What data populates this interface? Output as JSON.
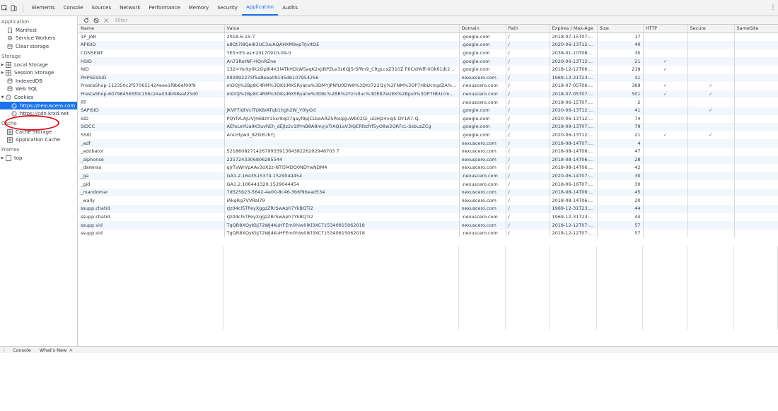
{
  "tabbar": {
    "tabs": [
      "Elements",
      "Console",
      "Sources",
      "Network",
      "Performance",
      "Memory",
      "Security",
      "Application",
      "Audits"
    ],
    "active": "Application"
  },
  "sidebar": {
    "application_heading": "Application",
    "manifest": "Manifest",
    "service_workers": "Service Workers",
    "clear_storage": "Clear storage",
    "storage_heading": "Storage",
    "local_storage": "Local Storage",
    "session_storage": "Session Storage",
    "indexeddb": "IndexedDB",
    "web_sql": "Web SQL",
    "cookies": "Cookies",
    "cookie_origin_1": "https://nexuscero.com",
    "cookie_origin_2": "https://cdn.krxd.net",
    "cache_heading": "Cache",
    "cache_storage": "Cache Storage",
    "application_cache": "Application Cache",
    "frames_heading": "Frames",
    "frame_top": "top"
  },
  "toolbar": {
    "filter_placeholder": "Filter"
  },
  "table": {
    "headers": [
      "Name",
      "Value",
      "Domain",
      "Path",
      "Expires / Max-Age",
      "Size",
      "HTTP",
      "Secure",
      "SameSite"
    ],
    "rows": [
      {
        "name": "1P_JAR",
        "value": "2018-6-15-7",
        "domain": ".google.com",
        "path": "/",
        "expires": "2018-07-15T07:1...",
        "size": "17",
        "http": "",
        "secure": "",
        "samesite": ""
      },
      {
        "name": "APISID",
        "value": "u8Qt7i8Qei83UC3a/AQAHXM9xpTrJvItQE",
        "domain": ".google.com",
        "path": "/",
        "expires": "2020-06-13T12:1...",
        "size": "40",
        "http": "",
        "secure": "",
        "samesite": ""
      },
      {
        "name": "CONSENT",
        "value": "YES+ES.es+20170910-09-0",
        "domain": ".google.com",
        "path": "/",
        "expires": "2038-01-10T08:0...",
        "size": "30",
        "http": "",
        "secure": "",
        "samesite": ""
      },
      {
        "name": "HSID",
        "value": "An71RotNF-HQnRZne",
        "domain": ".google.com",
        "path": "/",
        "expires": "2020-06-13T12:1...",
        "size": "21",
        "http": "✓",
        "secure": "",
        "samesite": ""
      },
      {
        "name": "NID",
        "value": "132=Yorky0k2Op8l4X1l4TkHDLW5aqK2xjIBPZLe3s6QJ5r5fRn9_CRgLcxZ310Z F6CIdWff-0Ok61dt2MzYJJ7T...",
        "domain": ".google.com",
        "path": "/",
        "expires": "2018-12-12T06:3...",
        "size": "219",
        "http": "✓",
        "secure": "",
        "samesite": ""
      },
      {
        "name": "PHPSESSID",
        "value": "092892275f5a8eaa09145db107954256",
        "domain": "nexuscero.com",
        "path": "/",
        "expires": "1969-12-31T23:5...",
        "size": "41",
        "http": "",
        "secure": "",
        "samesite": ""
      },
      {
        "name": "PrestaShop-112350c2f570651424eee1f8b6ef00f9",
        "value": "mDOJ%2Bp8C4RM%3DKsiMX5Ryatw%3DMYJPNfU0DW8%3DYz722l1y%2FNM%3DP7HbUcmplZA%3DM...",
        "domain": ".nexuscero.com",
        "path": "/",
        "expires": "2018-07-05T06:3...",
        "size": "369",
        "http": "✓",
        "secure": "✓",
        "samesite": ""
      },
      {
        "name": "PrestaShop-607984565f0c156c24a034b98eaf25d0",
        "value": "mDOJ%2Bp8C4RM%3DKsiMX5Ryatw%3D8L%2BR%2Fzrvlluc%3DE87eUEK%2Bps0%3DP7HbUcmplZA%3...",
        "domain": ".nexuscero.com",
        "path": "/",
        "expires": "2018-07-05T07:2...",
        "size": "501",
        "http": "✓",
        "secure": "✓",
        "samesite": ""
      },
      {
        "name": "RT",
        "value": "",
        "domain": ".nexuscero.com",
        "path": "/",
        "expires": "2018-06-15T07:3...",
        "size": "2",
        "http": "",
        "secure": "",
        "samesite": ""
      },
      {
        "name": "SAPISID",
        "value": "jKVF7idtVcITUK8/ATqb1hgh2W_Y0lyOd",
        "domain": ".google.com",
        "path": "/",
        "expires": "2020-06-13T12:1...",
        "size": "41",
        "http": "",
        "secure": "✓",
        "samesite": ""
      },
      {
        "name": "SID",
        "value": "PQYlVLAjUVJ46BzY15xr8qO7gayf9pjCLbeARZSPoUpJuWb02Gi_uGHJz4vigS-DY1A7-Q.",
        "domain": ".google.com",
        "path": "/",
        "expires": "2020-06-13T12:1...",
        "size": "74",
        "http": "",
        "secure": "",
        "samesite": ""
      },
      {
        "name": "SIDCC",
        "value": "AEfoLeYUa9K3uvhEh_dEJlz2v1IPmB8A8myjxTrAQ1aV3IQERfzdYf5yO8w2QRFcL-SsbuzZCg",
        "domain": ".google.com",
        "path": "/",
        "expires": "2018-09-13T07:2...",
        "size": "79",
        "http": "",
        "secure": "",
        "samesite": ""
      },
      {
        "name": "SSID",
        "value": "AnLHlyw3_8ZGEUbYJ",
        "domain": ".google.com",
        "path": "/",
        "expires": "2020-06-13T12:1...",
        "size": "21",
        "http": "✓",
        "secure": "✓",
        "samesite": ""
      },
      {
        "name": "_adf",
        "value": "",
        "domain": "nexuscero.com",
        "path": "/",
        "expires": "2018-08-14T07:2...",
        "size": "4",
        "http": "",
        "secure": "",
        "samesite": ""
      },
      {
        "name": "_adobator",
        "value": "5218608271426799339136438226202946703 7",
        "domain": "nexuscero.com",
        "path": "/",
        "expires": "2018-08-14T06:3...",
        "size": "47",
        "http": "",
        "secure": "",
        "samesite": ""
      },
      {
        "name": "_alphonse",
        "value": "2257243306806295544",
        "domain": "nexuscero.com",
        "path": "/",
        "expires": "2018-08-14T06:3...",
        "size": "28",
        "http": "",
        "secure": "",
        "samesite": ""
      },
      {
        "name": "_darenso",
        "value": "qjrTvWrVpAAv3oX2z-NTI5MDQ0NDYwNDM4",
        "domain": "nexuscero.com",
        "path": "/",
        "expires": "2018-08-14T06:3...",
        "size": "42",
        "http": "",
        "secure": "",
        "samesite": ""
      },
      {
        "name": "_ga",
        "value": "GA1.2.1643515374.1529044454",
        "domain": ".nexuscero.com",
        "path": "/",
        "expires": "2020-06-14T07:2...",
        "size": "30",
        "http": "",
        "secure": "",
        "samesite": ""
      },
      {
        "name": "_gid",
        "value": "GA1.2.106441320.1529044454",
        "domain": ".nexuscero.com",
        "path": "/",
        "expires": "2018-06-16T07:2...",
        "size": "30",
        "http": "",
        "secure": "",
        "samesite": ""
      },
      {
        "name": "_mandomar",
        "value": "7d525b23-5642-4e00-8c46-3b6f9bead534",
        "domain": "nexuscero.com",
        "path": "/",
        "expires": "2018-08-14T06:3...",
        "size": "45",
        "http": "",
        "secure": "",
        "samesite": ""
      },
      {
        "name": "_wally",
        "value": "iAkqRg7VVRal79",
        "domain": "nexuscero.com",
        "path": "/",
        "expires": "2018-08-14T06:3...",
        "size": "20",
        "http": "",
        "secure": "",
        "samesite": ""
      },
      {
        "name": "ssupp.chatid",
        "value": "rJz04cl5TPeyXggzZRrSwAph7YkBQTi2",
        "domain": "nexuscero.com",
        "path": "/",
        "expires": "1969-12-31T23:5...",
        "size": "44",
        "http": "",
        "secure": "",
        "samesite": ""
      },
      {
        "name": "ssupp.chatid",
        "value": "rJz04cl5TPeyXggzZRrSwAph7YkBQTi2",
        "domain": ".nexuscero.com",
        "path": "/",
        "expires": "1969-12-31T23:5...",
        "size": "44",
        "http": "",
        "secure": "",
        "samesite": ""
      },
      {
        "name": "ssupp.vid",
        "value": "TqQR8XQyKbj72WJ4KuHFEm0hiw0iKl3XC715340815062018",
        "domain": "nexuscero.com",
        "path": "/",
        "expires": "2018-12-12T07:1...",
        "size": "57",
        "http": "",
        "secure": "",
        "samesite": ""
      },
      {
        "name": "ssupp.vid",
        "value": "TqQR8XQyKbj72WJ4KuHFEm0hiw0iKl3XC715340815062018",
        "domain": ".nexuscero.com",
        "path": "/",
        "expires": "2018-12-12T07:1...",
        "size": "57",
        "http": "",
        "secure": "",
        "samesite": ""
      }
    ]
  },
  "drawer": {
    "tabs": [
      "Console",
      "What's New"
    ]
  },
  "colors": {
    "accent": "#1a73e8",
    "annotation_circle": "#e0101a",
    "stripe": "#f2f7fd"
  }
}
